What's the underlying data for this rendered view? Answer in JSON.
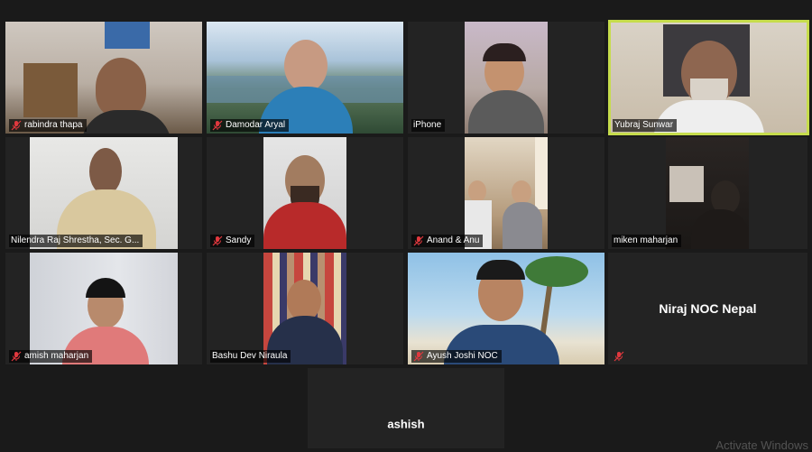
{
  "participants": [
    {
      "name": "rabindra thapa",
      "muted": true
    },
    {
      "name": "Damodar Aryal",
      "muted": true
    },
    {
      "name": "iPhone",
      "muted": false
    },
    {
      "name": "Yubraj Sunwar",
      "muted": false
    },
    {
      "name": "Nilendra Raj Shrestha, Sec. G...",
      "muted": false
    },
    {
      "name": "Sandy",
      "muted": true
    },
    {
      "name": "Anand & Anu",
      "muted": true
    },
    {
      "name": "miken maharjan",
      "muted": false
    },
    {
      "name": "amish maharjan",
      "muted": true
    },
    {
      "name": "Bashu Dev Niraula",
      "muted": false
    },
    {
      "name": "Ayush Joshi NOC",
      "muted": true
    },
    {
      "name": "Niraj NOC Nepal",
      "muted": true
    },
    {
      "name": "ashish",
      "muted": false
    }
  ],
  "active_speaker": "Yubraj Sunwar",
  "colors": {
    "background": "#1a1a1a",
    "tile": "#232323",
    "active_border": "#c6dc4c",
    "mute_red": "#e0383e"
  },
  "watermark": "Activate Windows"
}
